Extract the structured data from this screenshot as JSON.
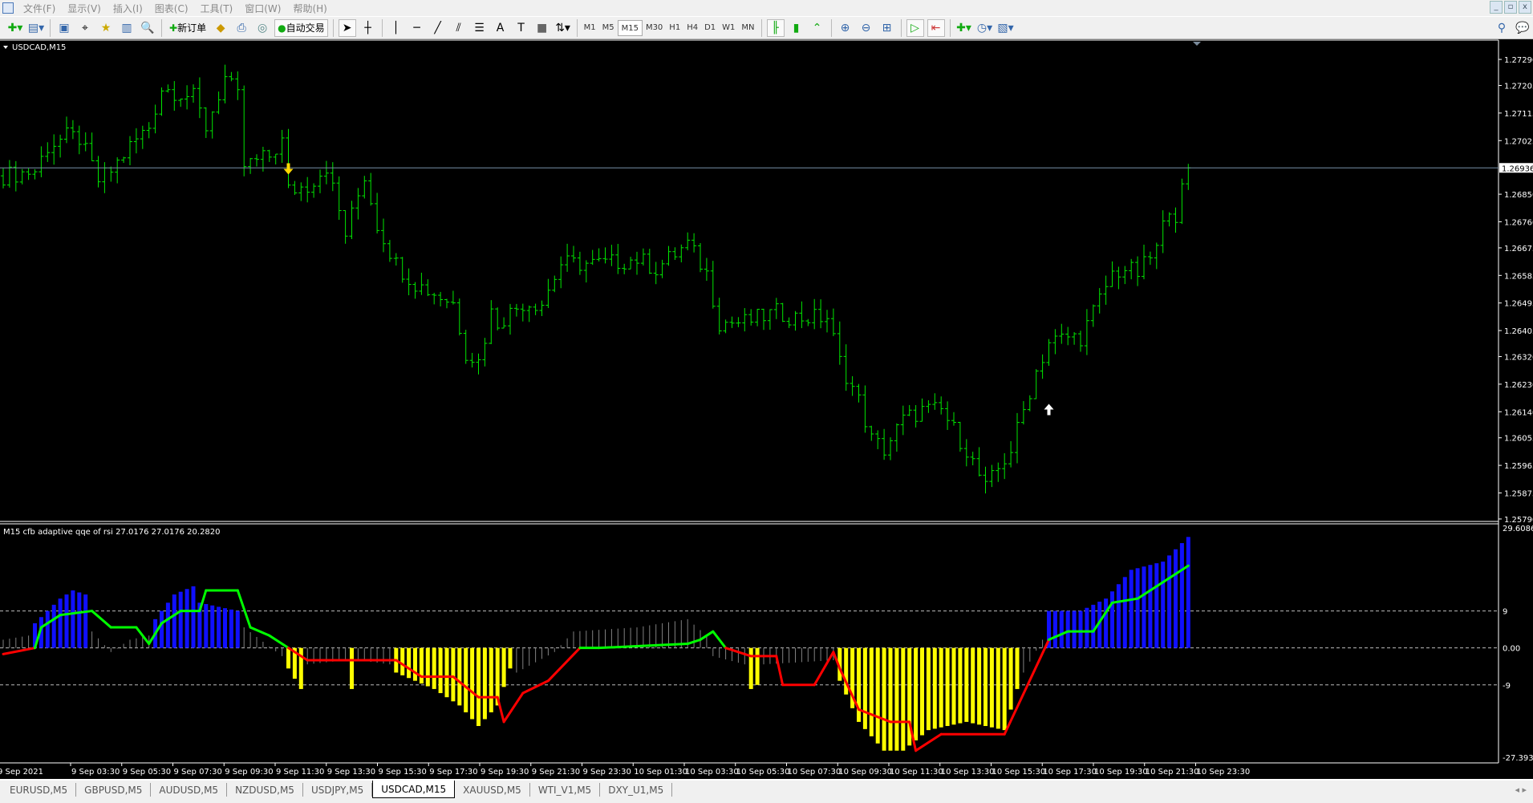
{
  "menu": [
    "文件(F)",
    "显示(V)",
    "插入(I)",
    "图表(C)",
    "工具(T)",
    "窗口(W)",
    "帮助(H)"
  ],
  "toolbar": {
    "new_order": "新订单",
    "auto_trading": "自动交易",
    "timeframes": [
      "M1",
      "M5",
      "M15",
      "M30",
      "H1",
      "H4",
      "D1",
      "W1",
      "MN"
    ],
    "active_timeframe": "M15"
  },
  "window_controls": [
    "_",
    "▫",
    "x"
  ],
  "chart": {
    "title": "USDCAD,M15",
    "current_price": "1.26936",
    "price_ylim": [
      1.25782,
      1.27353
    ],
    "price_ticks": [
      "1.27290",
      "1.27205",
      "1.27115",
      "1.27025",
      "1.26850",
      "1.26760",
      "1.26675",
      "1.26585",
      "1.26495",
      "1.26405",
      "1.26320",
      "1.26230",
      "1.26140",
      "1.26055",
      "1.25965",
      "1.25875",
      "1.25790"
    ],
    "bar_count": 188,
    "bar_color": "#00e600",
    "close_keypoints": [
      [
        0,
        1.2691
      ],
      [
        5,
        1.26926
      ],
      [
        7,
        1.27006
      ],
      [
        10,
        1.27038
      ],
      [
        12,
        1.27032
      ],
      [
        15,
        1.26894
      ],
      [
        17,
        1.26926
      ],
      [
        20,
        1.27006
      ],
      [
        23,
        1.2707
      ],
      [
        25,
        1.27197
      ],
      [
        28,
        1.27181
      ],
      [
        30,
        1.27166
      ],
      [
        32,
        1.2707
      ],
      [
        35,
        1.27229
      ],
      [
        37,
        1.27166
      ],
      [
        38,
        1.26942
      ],
      [
        42,
        1.26974
      ],
      [
        44,
        1.27022
      ],
      [
        45,
        1.26862
      ],
      [
        48,
        1.26878
      ],
      [
        51,
        1.26942
      ],
      [
        54,
        1.26719
      ],
      [
        57,
        1.2691
      ],
      [
        59,
        1.26751
      ],
      [
        62,
        1.26623
      ],
      [
        65,
        1.26559
      ],
      [
        68,
        1.26527
      ],
      [
        71,
        1.26495
      ],
      [
        73,
        1.26336
      ],
      [
        75,
        1.26304
      ],
      [
        77,
        1.26464
      ],
      [
        78,
        1.26432
      ],
      [
        82,
        1.26495
      ],
      [
        85,
        1.26495
      ],
      [
        88,
        1.26623
      ],
      [
        92,
        1.26623
      ],
      [
        95,
        1.26623
      ],
      [
        100,
        1.26639
      ],
      [
        103,
        1.26607
      ],
      [
        106,
        1.26655
      ],
      [
        108,
        1.26687
      ],
      [
        111,
        1.26591
      ],
      [
        113,
        1.26432
      ],
      [
        117,
        1.26432
      ],
      [
        122,
        1.26464
      ],
      [
        125,
        1.26448
      ],
      [
        130,
        1.26448
      ],
      [
        132,
        1.26304
      ],
      [
        135,
        1.26176
      ],
      [
        137,
        1.26049
      ],
      [
        139,
        1.26017
      ],
      [
        142,
        1.26113
      ],
      [
        145,
        1.26144
      ],
      [
        148,
        1.26144
      ],
      [
        150,
        1.26081
      ],
      [
        152,
        1.26017
      ],
      [
        155,
        1.25889
      ],
      [
        157,
        1.25953
      ],
      [
        159,
        1.26017
      ],
      [
        161,
        1.26144
      ],
      [
        163,
        1.26272
      ],
      [
        165,
        1.26368
      ],
      [
        168,
        1.26384
      ],
      [
        170,
        1.26384
      ],
      [
        172,
        1.26464
      ],
      [
        175,
        1.26591
      ],
      [
        177,
        1.26607
      ],
      [
        179,
        1.26591
      ],
      [
        182,
        1.26671
      ],
      [
        184,
        1.26815
      ],
      [
        185,
        1.26783
      ],
      [
        187,
        1.26936
      ]
    ],
    "arrows": [
      {
        "type": "sell",
        "bar": 45,
        "price": 1.2693,
        "color": "#ffd700"
      },
      {
        "type": "buy",
        "bar": 165,
        "price": 1.2615,
        "color": "#ffffff"
      }
    ]
  },
  "indicator": {
    "label": "M15  cfb adaptive qqe of rsi 27.0176 27.0176 20.2820",
    "ylim": [
      -27.393,
      29.6086
    ],
    "top_label": "29.6086",
    "bottom_label": "-27.393",
    "levels": [
      {
        "value": 9,
        "label": "9"
      },
      {
        "value": 0,
        "label": "0.00"
      },
      {
        "value": -9,
        "label": "-9"
      }
    ],
    "colors": {
      "b": "#1010ff",
      "y": "#ffff00",
      "g": "#808080",
      "up": "#00ff00",
      "down": "#ff0000"
    },
    "histogram_keypoints": [
      [
        0,
        2,
        "g"
      ],
      [
        4,
        3,
        "g"
      ],
      [
        5,
        6,
        "b"
      ],
      [
        9,
        12,
        "b"
      ],
      [
        11,
        14,
        "b"
      ],
      [
        13,
        13,
        "b"
      ],
      [
        14,
        4,
        "g"
      ],
      [
        17,
        -1,
        "g"
      ],
      [
        20,
        2,
        "g"
      ],
      [
        23,
        3,
        "g"
      ],
      [
        24,
        7,
        "b"
      ],
      [
        27,
        13,
        "b"
      ],
      [
        30,
        15,
        "b"
      ],
      [
        31,
        11,
        "b"
      ],
      [
        37,
        9,
        "b"
      ],
      [
        38,
        5,
        "g"
      ],
      [
        44,
        -2,
        "g"
      ],
      [
        45,
        -5,
        "y"
      ],
      [
        47,
        -10,
        "y"
      ],
      [
        48,
        -4,
        "g"
      ],
      [
        54,
        -3,
        "g"
      ],
      [
        55,
        -10,
        "y"
      ],
      [
        56,
        -3,
        "g"
      ],
      [
        61,
        -4,
        "g"
      ],
      [
        62,
        -6,
        "y"
      ],
      [
        68,
        -10,
        "y"
      ],
      [
        72,
        -14,
        "y"
      ],
      [
        75,
        -19,
        "y"
      ],
      [
        78,
        -14,
        "y"
      ],
      [
        80,
        -5,
        "y"
      ],
      [
        81,
        -6,
        "g"
      ],
      [
        87,
        -1,
        "g"
      ],
      [
        90,
        4,
        "g"
      ],
      [
        100,
        5,
        "g"
      ],
      [
        108,
        7,
        "g"
      ],
      [
        111,
        3,
        "g"
      ],
      [
        112,
        -2,
        "g"
      ],
      [
        117,
        -4,
        "g"
      ],
      [
        118,
        -10,
        "y"
      ],
      [
        119,
        -9,
        "y"
      ],
      [
        120,
        -4,
        "g"
      ],
      [
        131,
        -3,
        "g"
      ],
      [
        132,
        -8,
        "y"
      ],
      [
        135,
        -18,
        "y"
      ],
      [
        139,
        -25,
        "y"
      ],
      [
        142,
        -25,
        "y"
      ],
      [
        146,
        -20,
        "y"
      ],
      [
        152,
        -18,
        "y"
      ],
      [
        158,
        -20,
        "y"
      ],
      [
        160,
        -10,
        "y"
      ],
      [
        161,
        -6,
        "g"
      ],
      [
        164,
        2,
        "g"
      ],
      [
        165,
        9,
        "b"
      ],
      [
        170,
        9,
        "b"
      ],
      [
        174,
        12,
        "b"
      ],
      [
        178,
        19,
        "b"
      ],
      [
        183,
        21,
        "b"
      ],
      [
        187,
        27,
        "b"
      ]
    ],
    "line_keypoints": [
      [
        0,
        -1.5
      ],
      [
        5,
        0
      ],
      [
        6,
        5
      ],
      [
        9,
        8
      ],
      [
        14,
        9
      ],
      [
        17,
        5
      ],
      [
        21,
        5
      ],
      [
        23,
        1
      ],
      [
        25,
        6
      ],
      [
        28,
        9
      ],
      [
        31,
        9
      ],
      [
        32,
        14
      ],
      [
        37,
        14
      ],
      [
        39,
        5
      ],
      [
        42,
        3
      ],
      [
        45,
        0
      ],
      [
        48,
        -3
      ],
      [
        62,
        -3
      ],
      [
        66,
        -7
      ],
      [
        71,
        -7
      ],
      [
        75,
        -12
      ],
      [
        78,
        -12
      ],
      [
        79,
        -18
      ],
      [
        82,
        -11
      ],
      [
        86,
        -8
      ],
      [
        91,
        0
      ],
      [
        94,
        0
      ],
      [
        108,
        1
      ],
      [
        110,
        2
      ],
      [
        112,
        4
      ],
      [
        114,
        0
      ],
      [
        118,
        -2
      ],
      [
        122,
        -2
      ],
      [
        123,
        -9
      ],
      [
        128,
        -9
      ],
      [
        131,
        -1
      ],
      [
        132,
        -5
      ],
      [
        135,
        -15
      ],
      [
        140,
        -18
      ],
      [
        143,
        -18
      ],
      [
        144,
        -25
      ],
      [
        148,
        -21
      ],
      [
        158,
        -21
      ],
      [
        165,
        2
      ],
      [
        168,
        4
      ],
      [
        172,
        4
      ],
      [
        175,
        11
      ],
      [
        179,
        12
      ],
      [
        183,
        16
      ],
      [
        187,
        20
      ]
    ]
  },
  "time_labels": [
    "9 Sep 2021",
    "9 Sep 03:30",
    "9 Sep 05:30",
    "9 Sep 07:30",
    "9 Sep 09:30",
    "9 Sep 11:30",
    "9 Sep 13:30",
    "9 Sep 15:30",
    "9 Sep 17:30",
    "9 Sep 19:30",
    "9 Sep 21:30",
    "9 Sep 23:30",
    "10 Sep 01:30",
    "10 Sep 03:30",
    "10 Sep 05:30",
    "10 Sep 07:30",
    "10 Sep 09:30",
    "10 Sep 11:30",
    "10 Sep 13:30",
    "10 Sep 15:30",
    "10 Sep 17:30",
    "10 Sep 19:30",
    "10 Sep 21:30",
    "10 Sep 23:30"
  ],
  "tabs": [
    {
      "label": "EURUSD,M5"
    },
    {
      "label": "GBPUSD,M5"
    },
    {
      "label": "AUDUSD,M5"
    },
    {
      "label": "NZDUSD,M5"
    },
    {
      "label": "USDJPY,M5"
    },
    {
      "label": "USDCAD,M15",
      "active": true
    },
    {
      "label": "XAUUSD,M5"
    },
    {
      "label": "WTI_V1,M5"
    },
    {
      "label": "DXY_U1,M5"
    }
  ]
}
